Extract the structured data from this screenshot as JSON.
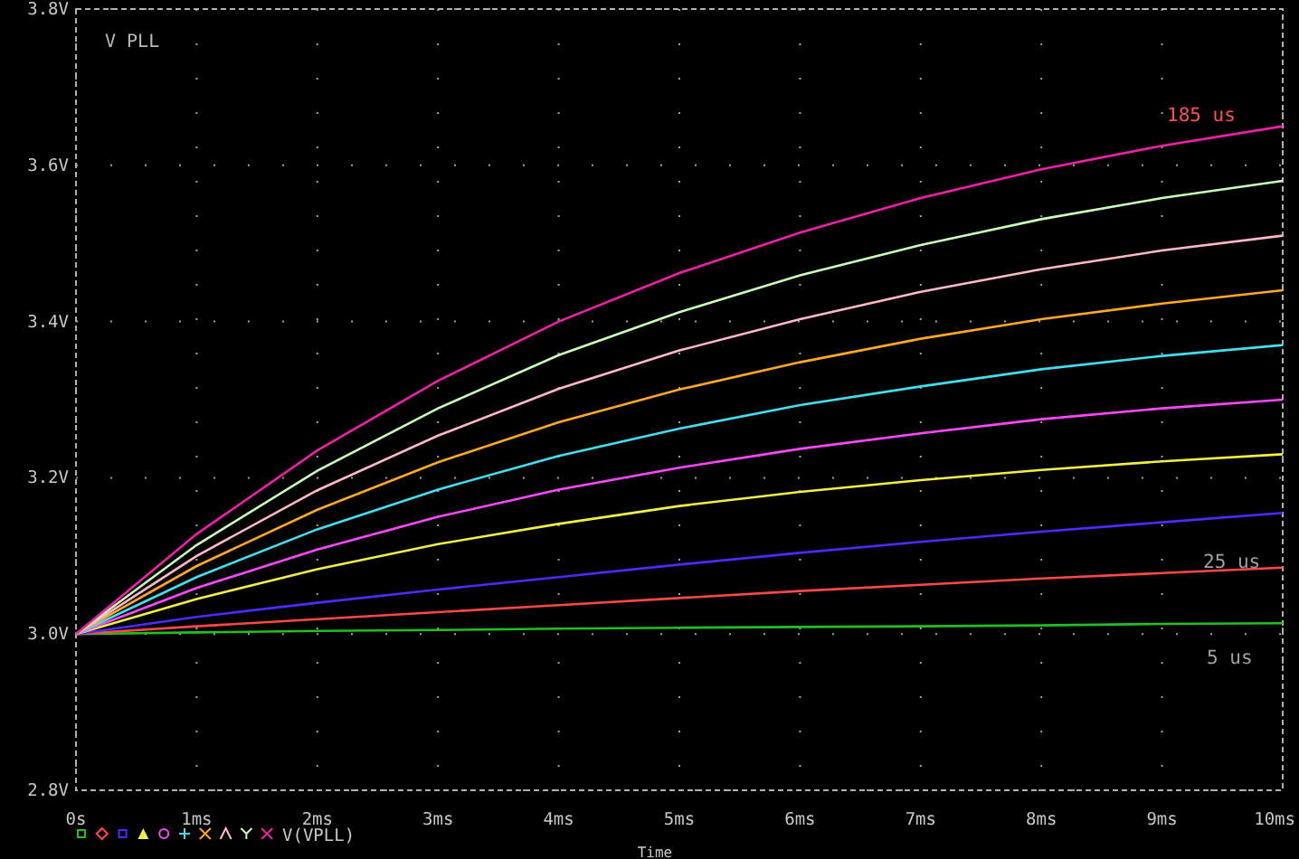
{
  "chart": {
    "chart_data": {
      "type": "line",
      "title": "V PLL",
      "xlabel": "Time",
      "grid": true,
      "x": [
        0,
        1,
        2,
        3,
        4,
        5,
        6,
        7,
        8,
        9,
        10
      ],
      "xlim": [
        0,
        10
      ],
      "ylim": [
        2.8,
        3.8
      ],
      "xticks": [
        {
          "value": 0,
          "label": "0s"
        },
        {
          "value": 1,
          "label": "1ms"
        },
        {
          "value": 2,
          "label": "2ms"
        },
        {
          "value": 3,
          "label": "3ms"
        },
        {
          "value": 4,
          "label": "4ms"
        },
        {
          "value": 5,
          "label": "5ms"
        },
        {
          "value": 6,
          "label": "6ms"
        },
        {
          "value": 7,
          "label": "7ms"
        },
        {
          "value": 8,
          "label": "8ms"
        },
        {
          "value": 9,
          "label": "9ms"
        },
        {
          "value": 10,
          "label": "10ms"
        }
      ],
      "yticks": [
        {
          "value": 2.8,
          "label": "2.8V"
        },
        {
          "value": 3.0,
          "label": "3.0V"
        },
        {
          "value": 3.2,
          "label": "3.2V"
        },
        {
          "value": 3.4,
          "label": "3.4V"
        },
        {
          "value": 3.6,
          "label": "3.6V"
        },
        {
          "value": 3.8,
          "label": "3.8V"
        }
      ],
      "series": [
        {
          "color": "#20c020",
          "values": [
            3.0,
            3.002,
            3.004,
            3.005,
            3.007,
            3.008,
            3.009,
            3.01,
            3.011,
            3.013,
            3.014
          ]
        },
        {
          "color": "#ff4848",
          "values": [
            3.0,
            3.01,
            3.019,
            3.028,
            3.037,
            3.046,
            3.055,
            3.063,
            3.071,
            3.078,
            3.085
          ]
        },
        {
          "color": "#4a2cff",
          "values": [
            3.0,
            3.022,
            3.04,
            3.057,
            3.073,
            3.089,
            3.104,
            3.118,
            3.131,
            3.143,
            3.155
          ]
        },
        {
          "color": "#f0f040",
          "values": [
            3.0,
            3.045,
            3.083,
            3.115,
            3.141,
            3.164,
            3.182,
            3.197,
            3.21,
            3.221,
            3.23
          ]
        },
        {
          "color": "#ff48ff",
          "values": [
            3.0,
            3.059,
            3.108,
            3.15,
            3.185,
            3.213,
            3.237,
            3.257,
            3.275,
            3.289,
            3.3
          ]
        },
        {
          "color": "#40e0f0",
          "values": [
            3.0,
            3.073,
            3.134,
            3.185,
            3.228,
            3.263,
            3.293,
            3.317,
            3.339,
            3.356,
            3.37
          ]
        },
        {
          "color": "#ffa820",
          "values": [
            3.0,
            3.087,
            3.159,
            3.22,
            3.271,
            3.313,
            3.348,
            3.378,
            3.403,
            3.423,
            3.44
          ]
        },
        {
          "color": "#ffb8c8",
          "values": [
            3.0,
            3.1,
            3.184,
            3.254,
            3.314,
            3.363,
            3.403,
            3.438,
            3.467,
            3.491,
            3.51
          ]
        },
        {
          "color": "#c8ffb8",
          "values": [
            3.0,
            3.114,
            3.209,
            3.289,
            3.357,
            3.412,
            3.459,
            3.498,
            3.531,
            3.558,
            3.58
          ]
        },
        {
          "color": "#f020a8",
          "values": [
            3.0,
            3.128,
            3.235,
            3.324,
            3.4,
            3.462,
            3.514,
            3.558,
            3.595,
            3.625,
            3.65
          ]
        }
      ],
      "annotations": [
        "185 us",
        "25 us",
        "5 us"
      ]
    },
    "legend": {
      "label": "V(VPLL)",
      "markers": [
        {
          "kind": "square",
          "color": "#20c020"
        },
        {
          "kind": "diamond",
          "color": "#ff4848"
        },
        {
          "kind": "square",
          "color": "#4a2cff"
        },
        {
          "kind": "triangle",
          "color": "#f0f040"
        },
        {
          "kind": "circle",
          "color": "#ff48ff"
        },
        {
          "kind": "plus",
          "color": "#40e0f0"
        },
        {
          "kind": "cross",
          "color": "#ffa820"
        },
        {
          "kind": "caret",
          "color": "#ffb8c8"
        },
        {
          "kind": "wye",
          "color": "#c8ffb8"
        },
        {
          "kind": "cross",
          "color": "#f020a8"
        }
      ]
    }
  }
}
